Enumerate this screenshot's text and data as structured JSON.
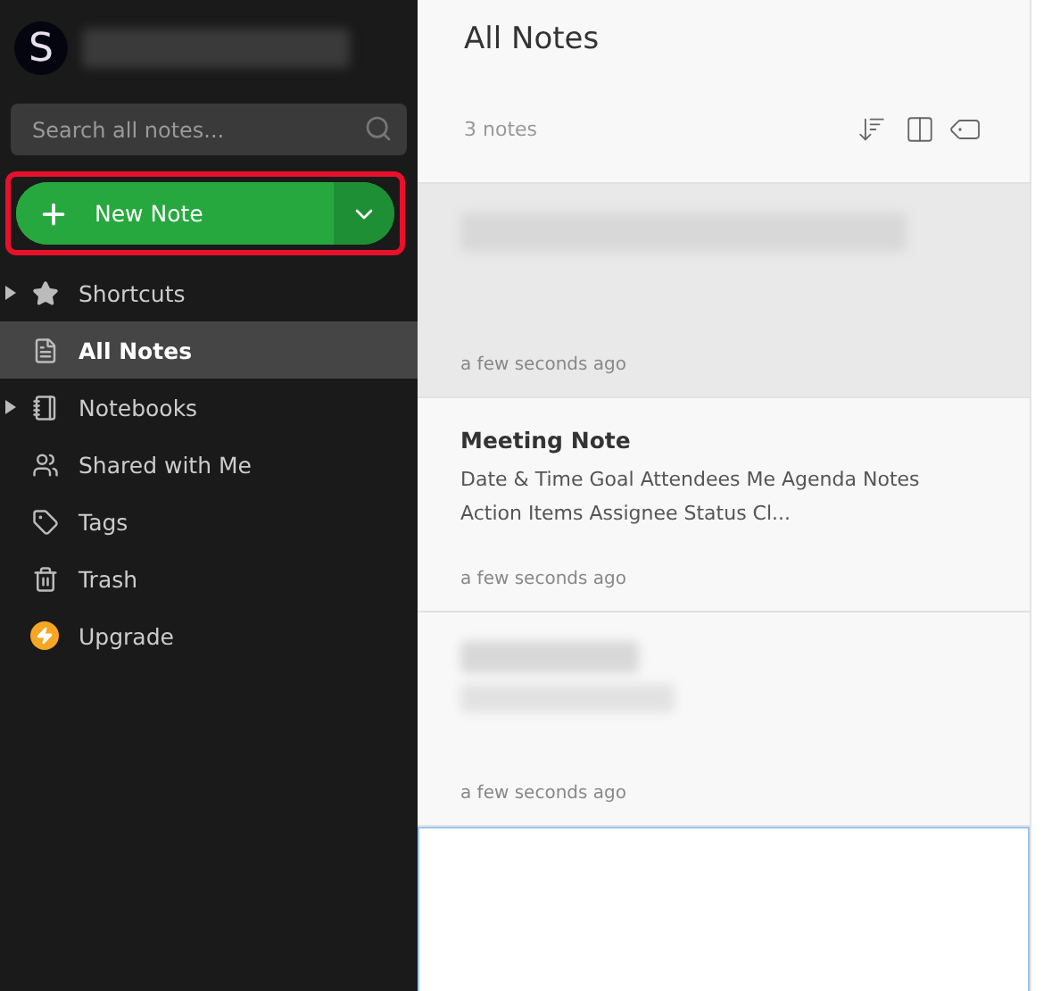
{
  "account": {
    "avatar_letter": "S",
    "name_blurred": true
  },
  "search": {
    "placeholder": "Search all notes..."
  },
  "new_note": {
    "label": "New Note",
    "highlighted": true
  },
  "sidebar": {
    "items": [
      {
        "label": "Shortcuts",
        "kind": "star",
        "expandable": true,
        "selected": false
      },
      {
        "label": "All Notes",
        "kind": "note",
        "expandable": false,
        "selected": true
      },
      {
        "label": "Notebooks",
        "kind": "notebook",
        "expandable": true,
        "selected": false
      },
      {
        "label": "Shared with Me",
        "kind": "people",
        "expandable": false,
        "selected": false
      },
      {
        "label": "Tags",
        "kind": "tag",
        "expandable": false,
        "selected": false
      },
      {
        "label": "Trash",
        "kind": "trash",
        "expandable": false,
        "selected": false
      },
      {
        "label": "Upgrade",
        "kind": "upgrade",
        "expandable": false,
        "selected": false
      }
    ]
  },
  "list": {
    "title": "All Notes",
    "count": "3 notes",
    "notes": [
      {
        "kind": "blurred_title",
        "selected": true,
        "time": "a few seconds ago"
      },
      {
        "kind": "text",
        "selected": false,
        "title": "Meeting Note",
        "snippet": "Date & Time Goal Attendees Me Agenda Notes Action Items Assignee Status Cl...",
        "time": "a few seconds ago"
      },
      {
        "kind": "blurred_title_snippet",
        "selected": false,
        "time": "a few seconds ago"
      }
    ]
  }
}
